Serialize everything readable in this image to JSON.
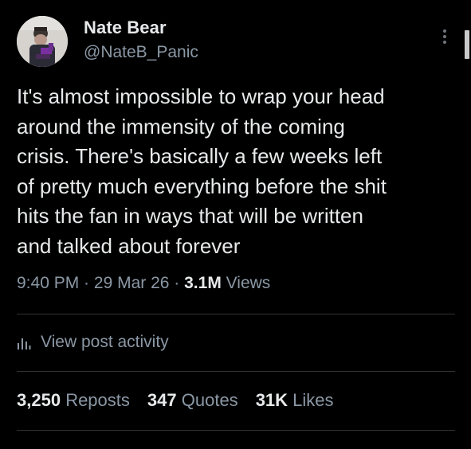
{
  "author": {
    "name": "Nate Bear",
    "handle": "@NateB_Panic"
  },
  "post": {
    "text": "It's almost impossible to wrap your head\naround the immensity of the coming\ncrisis. There's basically a few weeks left\nof pretty much everything before the shit\nhits the fan in ways that will be written\nand talked about forever",
    "time": "9:40 PM",
    "separator": " · ",
    "date": "29 Mar 26",
    "views_count": "3.1M",
    "views_label": " Views"
  },
  "activity": {
    "label": "View post activity",
    "icon": "analytics-bars-icon"
  },
  "stats": {
    "reposts_count": "3,250",
    "reposts_label": "Reposts",
    "quotes_count": "347",
    "quotes_label": "Quotes",
    "likes_count": "31K",
    "likes_label": "Likes"
  },
  "icons": {
    "more": "more-vertical-icon"
  },
  "colors": {
    "background": "#000000",
    "primary_text": "#e7e9ea",
    "secondary_text": "#8b98a5",
    "divider": "#2f3336"
  }
}
